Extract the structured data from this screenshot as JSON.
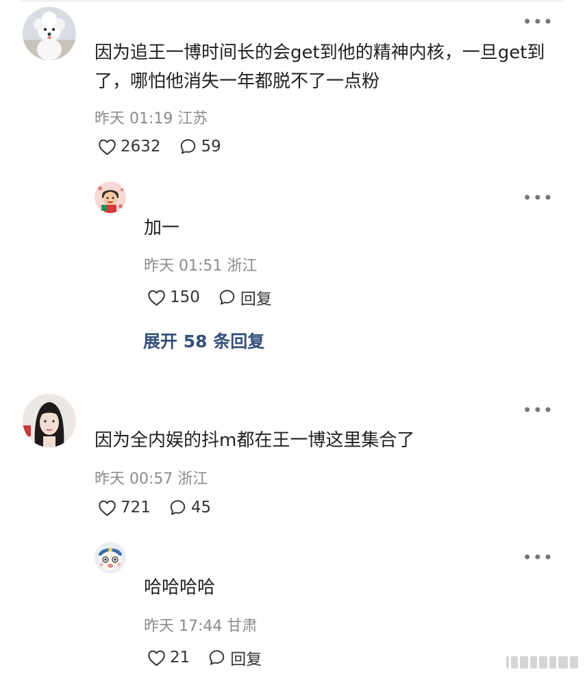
{
  "comments": [
    {
      "text": "因为追王一博时间长的会get到他的精神内核，一旦get到了，哪怕他消失一年都脱不了一点粉",
      "time": "昨天 01:19",
      "location": "江苏",
      "likes": "2632",
      "replies": "59",
      "avatar_icon": "white-poodle-avatar",
      "reply": {
        "text": "加一",
        "time": "昨天 01:51",
        "location": "浙江",
        "likes": "150",
        "reply_label": "回复",
        "avatar_icon": "cartoon-mascot-avatar"
      },
      "expand_label": "展开 58 条回复"
    },
    {
      "text": "因为全内娱的抖m都在王一博这里集合了",
      "time": "昨天 00:57",
      "location": "浙江",
      "likes": "721",
      "replies": "45",
      "avatar_icon": "woman-portrait-avatar",
      "reply": {
        "text": "哈哈哈哈",
        "time": "昨天 17:44",
        "location": "甘肃",
        "likes": "21",
        "reply_label": "回复",
        "avatar_icon": "cartoon-character-avatar"
      }
    }
  ],
  "more_icon": "more-dots-icon",
  "colors": {
    "link": "#35507a",
    "meta": "#8a8a8a",
    "text": "#1f1f1f"
  }
}
